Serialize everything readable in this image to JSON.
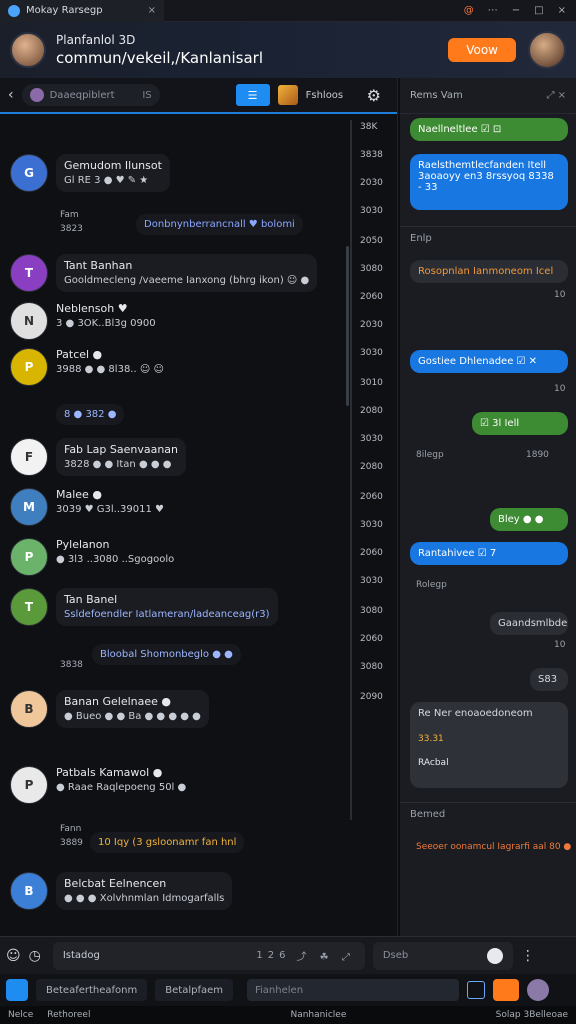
{
  "titlebar": {
    "tab_title": "Mokay Rarsegp",
    "close": "×",
    "controls": [
      "@",
      "⋯",
      "−",
      "□",
      "×"
    ]
  },
  "header": {
    "line1": "Planfanlol 3D",
    "line2": "commun/vekeil,/Kanlanisarl",
    "action": "Voow"
  },
  "left_toolbar": {
    "search": "Daaeqpiblert",
    "search_count": "IS",
    "sticker_label": "Fshloos"
  },
  "messages": [
    {
      "name": "Gemudom Ilunsot",
      "line": "Gl RE 3 ● ♥ ✎ ★",
      "initials": "G",
      "color": "#3b6fd1"
    },
    {
      "name": "Tant Banhan",
      "line": "Gooldmecleng /vaeeme Ianxong (bhrg ikon) ☺ ●",
      "initials": "T",
      "color": "#8a3fc2"
    },
    {
      "name": "Neblensoh ♥",
      "line": "3 ● 3OK..Bl3g 0900",
      "initials": "N",
      "color": "#e0e0e0"
    },
    {
      "name": "Patcel ●",
      "line": "3988 ● ● 8l38.. ☺ ☺",
      "initials": "P",
      "color": "#d8b500"
    },
    {
      "name": "Fab Lap Saenvaanan",
      "line": "3828 ● ● Itan ● ● ●",
      "initials": "F",
      "color": "#f2f2f2"
    },
    {
      "name": "Malee ●",
      "line": "3039 ♥ G3l..39011 ♥",
      "initials": "M",
      "color": "#3f7fbf"
    },
    {
      "name": "Pylelanon",
      "line": "● 3l3 ..3080 ..Sgogoolo",
      "initials": "P",
      "color": "#6bb36b"
    },
    {
      "name": "Tan Banel",
      "line": "Ssldefoendler Iatlameran/ladeanceag(r3)",
      "initials": "T",
      "color": "#5a9a3a"
    },
    {
      "name": "Banan Gelelnaee ●",
      "line": "● Bueo ● ● Ba ● ● ● ● ●",
      "initials": "B",
      "color": "#f0c79a"
    },
    {
      "name": "Patbals Kamawol ●",
      "line": "● Raae Raqlepoeng 50l ●",
      "initials": "P",
      "color": "#e9e9e9"
    },
    {
      "name": "Belcbat Eelnencen",
      "line": "● ● ● Xolvhnmlan Idmogarfalls",
      "initials": "B",
      "color": "#3b7fd6"
    }
  ],
  "subs": [
    {
      "time": "Fam",
      "code": "3823",
      "text": "Donbnynberrancnall ♥ bolomi"
    },
    {
      "time": "",
      "code": "381",
      "text": "8 ● 382 ●"
    },
    {
      "time": "",
      "code": "3838",
      "text": "Bloobal Shomonbeglo ● ●"
    },
    {
      "time": "Fann",
      "code": "3889",
      "text": "10 Iqy (3 gsloonamr fan hnl"
    }
  ],
  "times": [
    "38K",
    "3838",
    "2030",
    "3030",
    "2050",
    "3080",
    "2060",
    "2030",
    "3030",
    "3010",
    "2080",
    "3030",
    "2080",
    "2060",
    "3030",
    "2060",
    "3030",
    "3080",
    "2060",
    "3080",
    "2090"
  ],
  "right_panel": {
    "header": "Rems Vam",
    "header_icons": "⤢ ×",
    "items": [
      {
        "text": "Naellneltlee ☑ ⊡",
        "style": "green"
      },
      {
        "text": "Raelsthemtlecfanden Itell  3aoaoyy en3 8rssyoq 8338 - 33",
        "style": "blue"
      },
      {
        "text": "Rosopnlan Ianmoneom Icel",
        "style": "dark"
      },
      {
        "text": "Gostiee Dhlenadee ☑ ✕",
        "style": "blue"
      },
      {
        "text": "☑ 3l Iell",
        "style": "green"
      },
      {
        "text": "Bley ● ●",
        "style": "green"
      },
      {
        "text": "Rantahivee ☑ 7",
        "style": "blue"
      },
      {
        "text": "Gaandsmlbder",
        "style": "dark"
      },
      {
        "text": "S83",
        "style": "dark"
      },
      {
        "text": "Re Ner enoaoedoneom",
        "style": "dark"
      }
    ],
    "section1": "Enlp",
    "section2": "Bemed",
    "meta": [
      "10",
      "10",
      "10",
      "8ilegp",
      "1890",
      "Rolegp",
      "10",
      "33.31",
      "RAcbal"
    ],
    "section2_line": "Seeoer oonamcul Iagrarfi aal 80 ●"
  },
  "input": {
    "placeholder": "Istadog",
    "count": "126",
    "icons": "⤴ ☘ ⤢",
    "search": "Dseb"
  },
  "bottom": {
    "tab1": "Beteafertheafonm",
    "tab2": "Betalpfaem",
    "field": "Fianhelen"
  },
  "status": {
    "left": "Nelce",
    "mid": "Rethoreel",
    "right1": "Nanhaniclee",
    "right2": "Solap 3Belleoae"
  }
}
